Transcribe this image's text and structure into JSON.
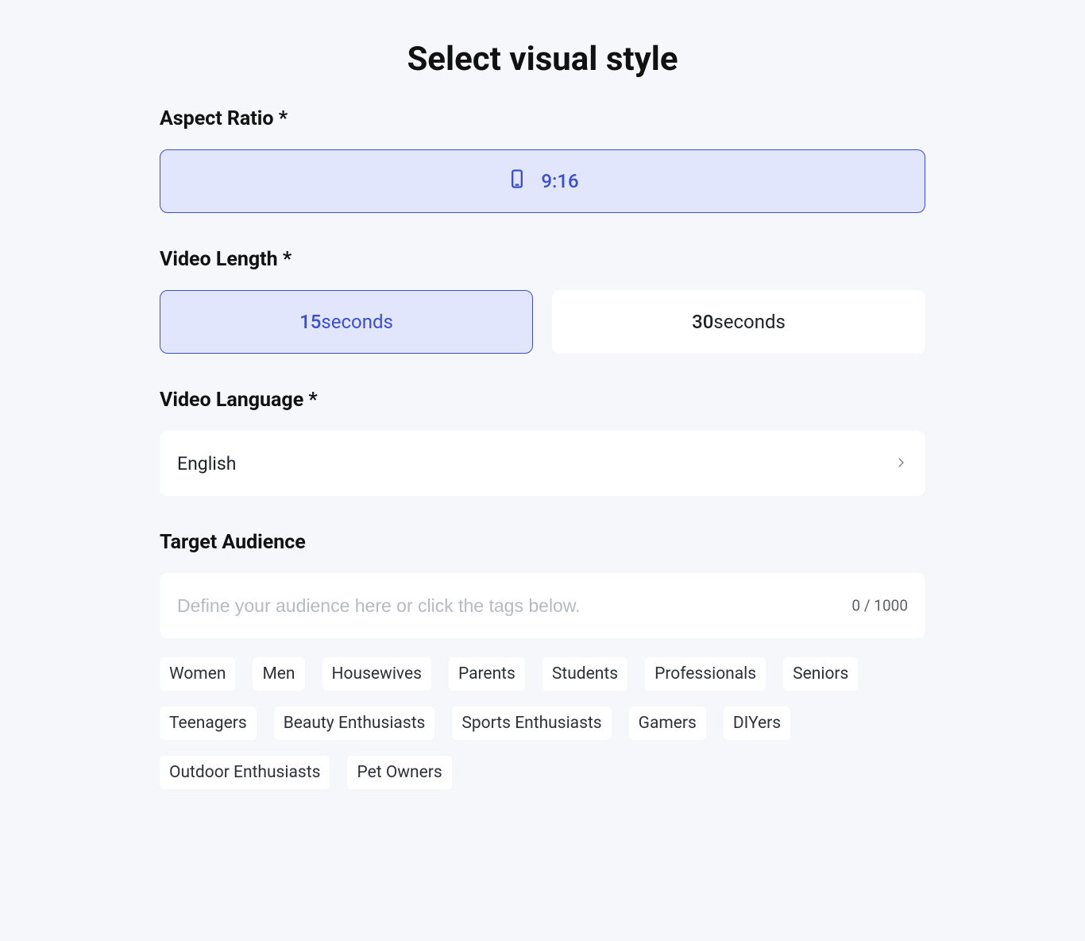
{
  "title": "Select visual style",
  "aspect": {
    "label": "Aspect Ratio *",
    "options": [
      {
        "label": "9:16",
        "selected": true
      }
    ]
  },
  "length": {
    "label": "Video Length *",
    "options": [
      {
        "value": "15",
        "unit": "seconds",
        "selected": true
      },
      {
        "value": "30",
        "unit": "seconds",
        "selected": false
      }
    ]
  },
  "language": {
    "label": "Video Language *",
    "value": "English"
  },
  "audience": {
    "label": "Target Audience",
    "placeholder": "Define your audience here or click the tags below.",
    "counter": "0 / 1000",
    "tags": [
      "Women",
      "Men",
      "Housewives",
      "Parents",
      "Students",
      "Professionals",
      "Seniors",
      "Teenagers",
      "Beauty Enthusiasts",
      "Sports Enthusiasts",
      "Gamers",
      "DIYers",
      "Outdoor Enthusiasts",
      "Pet Owners"
    ]
  }
}
